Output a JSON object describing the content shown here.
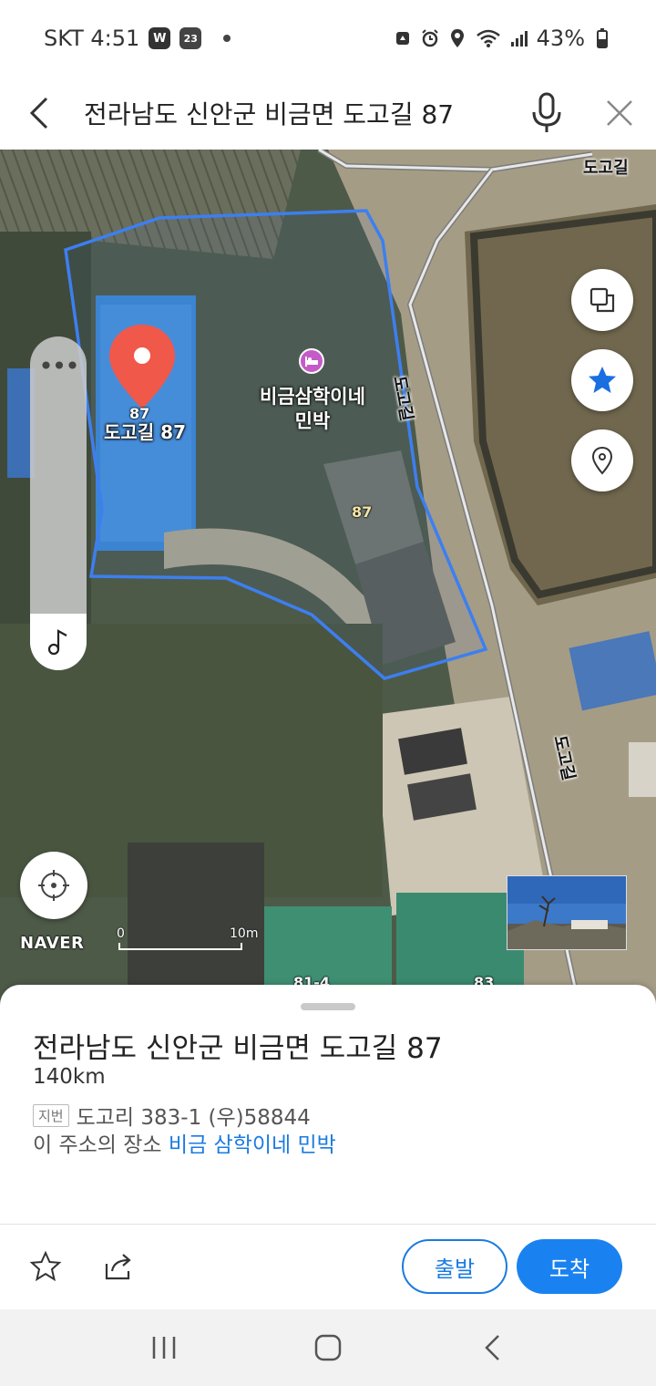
{
  "status_bar": {
    "carrier_time": "SKT 4:51",
    "badge_w": "W",
    "badge_cal": "23",
    "battery": "43%"
  },
  "search": {
    "query": "전라남도 신안군 비금면 도고길 87"
  },
  "map": {
    "marker_number": "87",
    "marker_address": "도고길 87",
    "poi_name": "비금삼학이네 민박",
    "building_number": "87",
    "road_label_top": "도고길",
    "road_label_mid": "도고길",
    "road_label_bottom": "도고길",
    "lot_label_1": "81-4",
    "lot_label_2": "83",
    "logo": "NAVER",
    "scale_start": "0",
    "scale_end": "10m",
    "side_pill_dots": "•••"
  },
  "sheet": {
    "title": "전라남도 신안군 비금면 도고길 87",
    "distance": "140km",
    "jibeon_tag": "지번",
    "jibeon_address": "도고리 383-1 (우)58844",
    "place_prefix": "이 주소의 장소",
    "place_link": "비금 삼학이네 민박"
  },
  "actions": {
    "start_label": "출발",
    "arrive_label": "도착"
  },
  "colors": {
    "accent": "#1a82f0",
    "marker": "#f0584a",
    "boundary": "#3d7ff0"
  }
}
